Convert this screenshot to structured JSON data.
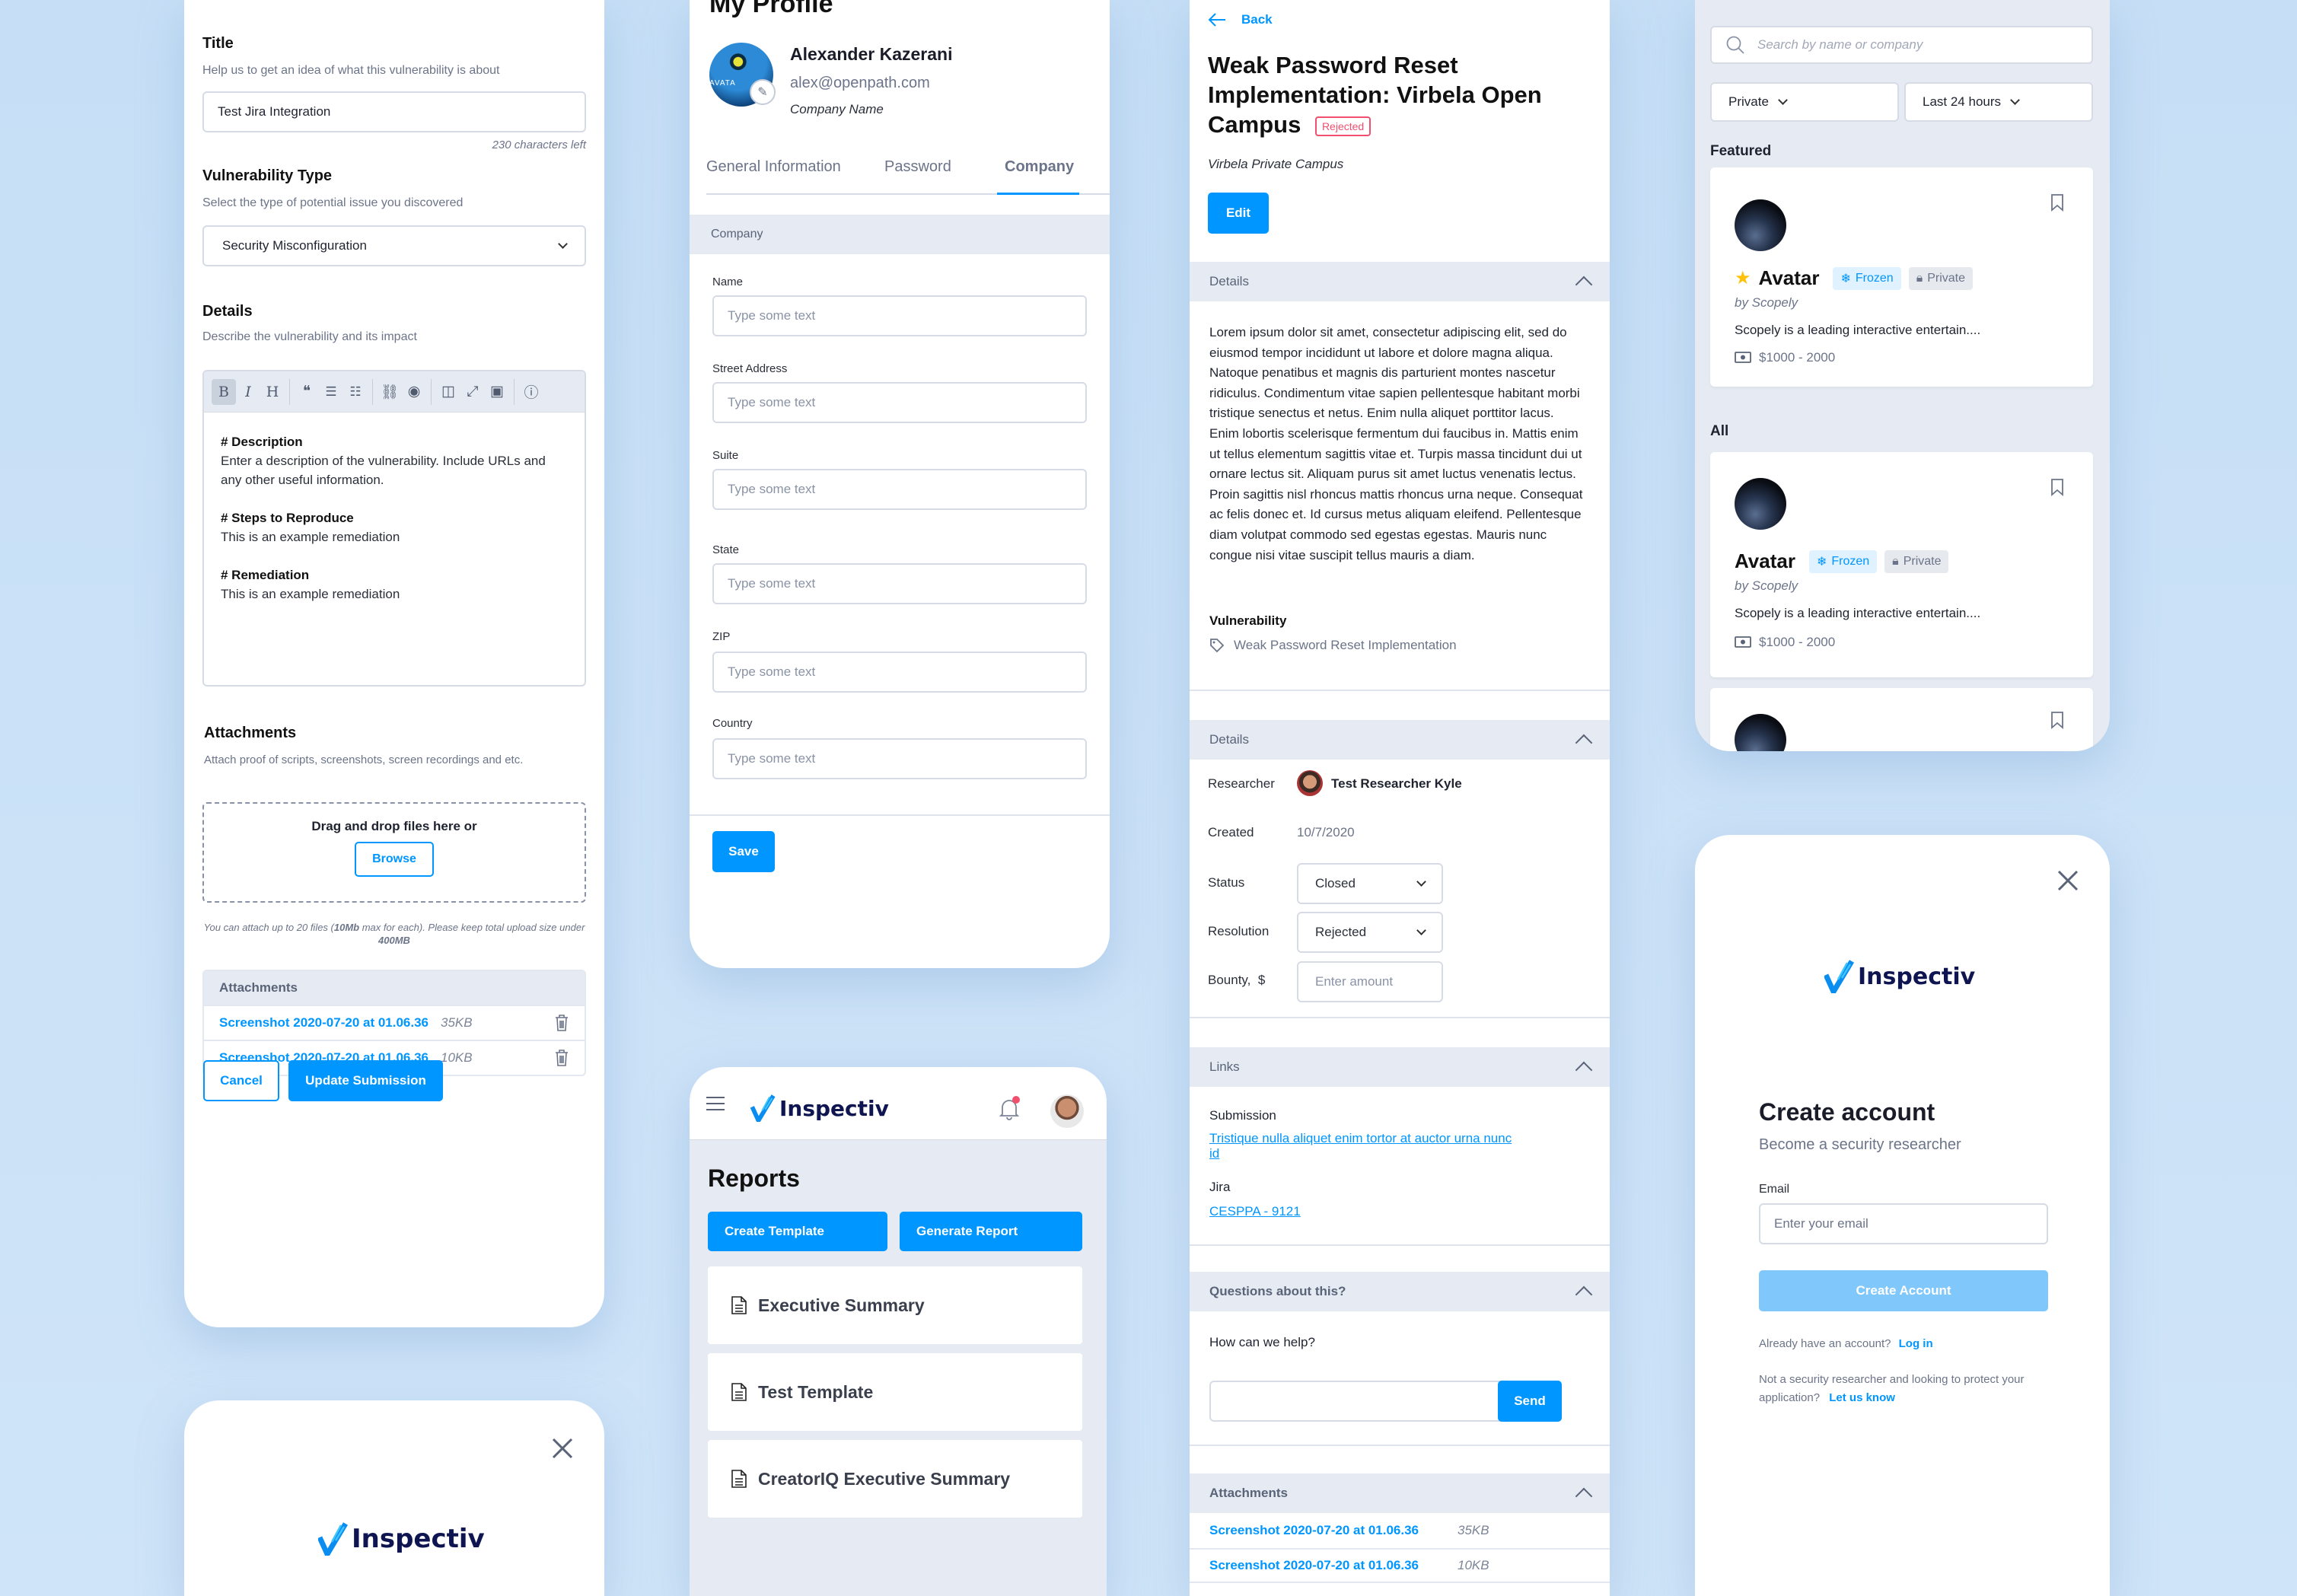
{
  "submission_form": {
    "title_label": "Title",
    "title_help": "Help us to get an idea of what this vulnerability is about",
    "title_value": "Test Jira Integration",
    "title_counter": "230 characters left",
    "type_label": "Vulnerability Type",
    "type_help": "Select the type of potential issue you discovered",
    "type_value": "Security Misconfiguration",
    "details_label": "Details",
    "details_help": "Describe the vulnerability and its impact",
    "toolbar": [
      "bold",
      "italic",
      "heading",
      "quote",
      "ordered-list",
      "unordered-list",
      "link",
      "preview",
      "side-by-side",
      "fullscreen",
      "image",
      "help"
    ],
    "editor": {
      "h1": "# Description",
      "p1": "Enter a description of the vulnerability. Include URLs and any other useful information.",
      "h2": "# Steps to Reproduce",
      "p2": "This is an example remediation",
      "h3": "# Remediation",
      "p3": "This is an example remediation"
    },
    "attachments_label": "Attachments",
    "attachments_help": "Attach proof of scripts, screenshots, screen recordings and etc.",
    "dropzone_text": "Drag and drop files here or",
    "browse_label": "Browse",
    "limit_note_1": "You can attach up to 20 files (",
    "limit_note_bold1": "10Mb",
    "limit_note_2": " max for each). Please keep total upload size under ",
    "limit_note_bold2": "400MB",
    "attachments_table_header": "Attachments",
    "files": [
      {
        "name": "Screenshot 2020-07-20 at 01.06.36",
        "size": "35KB"
      },
      {
        "name": "Screenshot 2020-07-20 at 01.06.36",
        "size": "10KB"
      }
    ],
    "cancel_label": "Cancel",
    "submit_label": "Update Submission"
  },
  "profile": {
    "page_title": "My Profile",
    "name": "Alexander Kazerani",
    "email": "alex@openpath.com",
    "company": "Company Name",
    "avatar_text": "AVATA",
    "tabs": [
      "General Information",
      "Password",
      "Company"
    ],
    "active_tab": "Company",
    "section_header": "Company",
    "fields": [
      {
        "label": "Name",
        "placeholder": "Type some text"
      },
      {
        "label": "Street Address",
        "placeholder": "Type some text"
      },
      {
        "label": "Suite",
        "placeholder": "Type some text"
      },
      {
        "label": "State",
        "placeholder": "Type some text"
      },
      {
        "label": "ZIP",
        "placeholder": "Type some text"
      },
      {
        "label": "Country",
        "placeholder": "Type some text"
      }
    ],
    "save_label": "Save"
  },
  "reports": {
    "brand": "Inspectiv",
    "page_title": "Reports",
    "create_template_label": "Create Template",
    "generate_report_label": "Generate Report",
    "items": [
      "Executive Summary",
      "Test Template",
      "CreatorIQ Executive Summary"
    ]
  },
  "report_detail": {
    "back_label": "Back",
    "title": "Weak Password Reset Implementation: Virbela Open Campus",
    "status_badge": "Rejected",
    "program": "Virbela Private Campus",
    "edit_label": "Edit",
    "details_header": "Details",
    "description": "Lorem ipsum dolor sit amet, consectetur adipiscing elit, sed do eiusmod tempor incididunt ut labore et dolore magna aliqua. Natoque penatibus et magnis dis parturient montes nascetur ridiculus. Condimentum vitae sapien pellentesque habitant morbi tristique senectus et netus. Enim nulla aliquet porttitor lacus. Enim lobortis scelerisque fermentum dui faucibus in. Mattis enim ut tellus elementum sagittis vitae et. Turpis massa tincidunt dui ut ornare lectus sit. Aliquam purus sit amet luctus venenatis lectus. Proin sagittis nisl rhoncus mattis rhoncus urna neque. Consequat ac felis donec et. Id cursus metus aliquam eleifend. Pellentesque diam volutpat commodo sed egestas egestas. Mauris nunc congue nisi vitae suscipit tellus mauris a diam.",
    "vulnerability_label": "Vulnerability",
    "vulnerability_value": "Weak Password Reset Implementation",
    "meta_header": "Details",
    "researcher_label": "Researcher",
    "researcher_name": "Test Researcher Kyle",
    "created_label": "Created",
    "created_value": "10/7/2020",
    "status_label": "Status",
    "status_value": "Closed",
    "resolution_label": "Resolution",
    "resolution_value": "Rejected",
    "bounty_label": "Bounty,  $",
    "bounty_placeholder": "Enter amount",
    "links_header": "Links",
    "submission_label": "Submission",
    "submission_link": "Tristique nulla aliquet enim tortor at auctor urna nunc id",
    "jira_label": "Jira",
    "jira_link": "CESPPA - 9121",
    "questions_header": "Questions about this?",
    "help_label": "How can we help?",
    "send_label": "Send",
    "attachments_header": "Attachments",
    "files": [
      {
        "name": "Screenshot 2020-07-20 at 01.06.36",
        "size": "35KB"
      },
      {
        "name": "Screenshot 2020-07-20 at 01.06.36",
        "size": "10KB"
      }
    ]
  },
  "programs": {
    "search_placeholder": "Search by name or company",
    "filter_visibility": "Private",
    "filter_time": "Last 24 hours",
    "featured_label": "Featured",
    "all_label": "All",
    "cards": [
      {
        "name": "Avatar",
        "company": "by Scopely",
        "featured": true,
        "badges": [
          "Frozen",
          "Private"
        ],
        "description": "Scopely is a leading interactive entertain....",
        "bounty": "$1000 - 2000"
      },
      {
        "name": "Avatar",
        "company": "by Scopely",
        "featured": false,
        "badges": [
          "Frozen",
          "Private"
        ],
        "description": "Scopely is a leading interactive entertain....",
        "bounty": "$1000 - 2000"
      }
    ]
  },
  "create_account": {
    "brand": "Inspectiv",
    "title": "Create account",
    "subtitle": "Become a security researcher",
    "email_label": "Email",
    "email_placeholder": "Enter your email",
    "submit_label": "Create Account",
    "login_prompt": "Already have an account?",
    "login_link": "Log in",
    "business_prompt": "Not a security researcher and looking to protect your application?",
    "business_link": "Let us know"
  },
  "splash": {
    "brand": "Inspectiv"
  },
  "colors": {
    "primary": "#0096ff",
    "brand_navy": "#0e1550",
    "rejected": "#f0506e",
    "section_bg": "#e6ebf3",
    "page_bg": "#c6dff6"
  }
}
